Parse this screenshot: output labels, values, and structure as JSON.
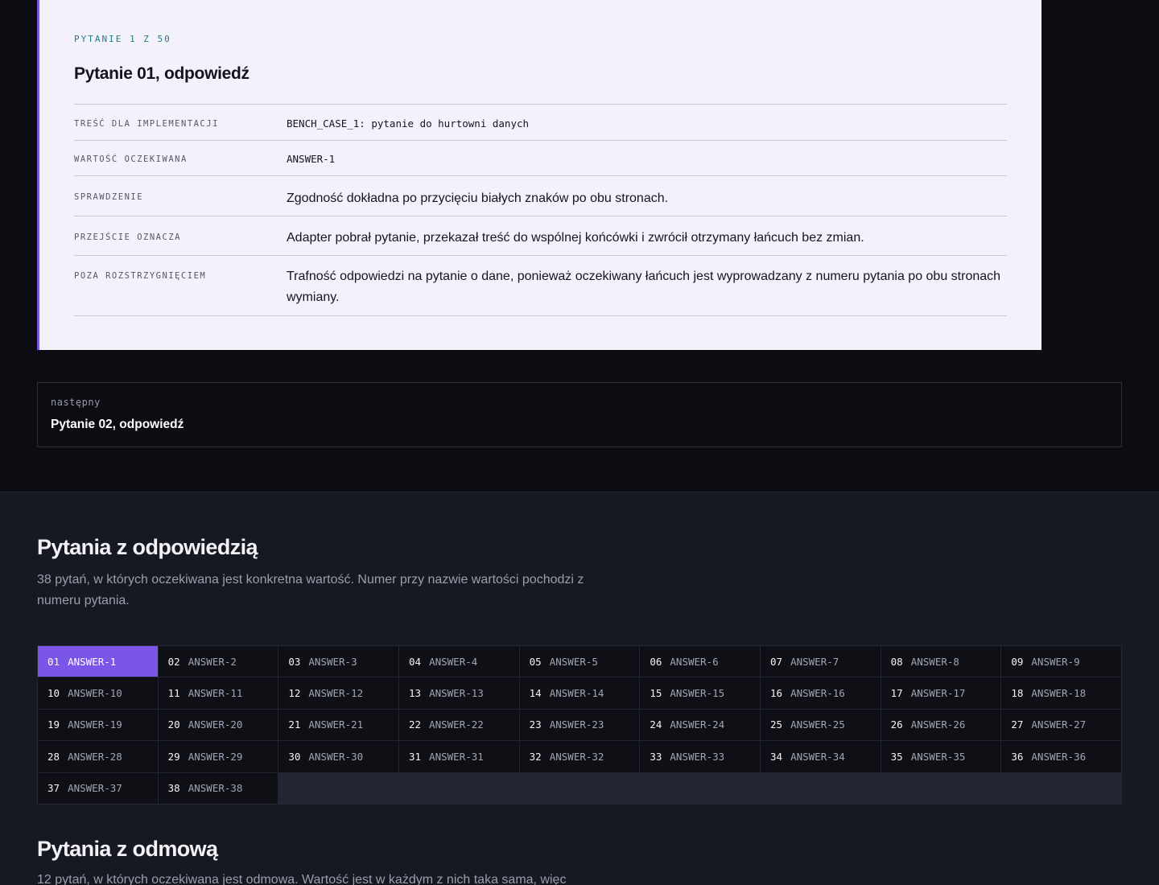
{
  "question_card": {
    "counter": "PYTANIE 1 Z 50",
    "title": "Pytanie 01, odpowiedź",
    "rows": [
      {
        "key": "TREŚĆ DLA IMPLEMENTACJI",
        "value": "BENCH_CASE_1: pytanie do hurtowni danych"
      },
      {
        "key": "WARTOŚĆ OCZEKIWANA",
        "value": "ANSWER-1"
      },
      {
        "key": "SPRAWDZENIE",
        "value": "Zgodność dokładna po przycięciu białych znaków po obu stronach."
      },
      {
        "key": "PRZEJŚCIE OZNACZA",
        "value": "Adapter pobrał pytanie, przekazał treść do wspólnej końcówki i zwrócił otrzymany łańcuch bez zmian."
      },
      {
        "key": "POZA ROZSTRZYGNIĘCIEM",
        "value": "Trafność odpowiedzi na pytanie o dane, ponieważ oczekiwany łańcuch jest wyprowadzany z numeru pytania po obu stronach wymiany."
      }
    ]
  },
  "next": {
    "label": "następny",
    "title": "Pytanie 02, odpowiedź"
  },
  "answer_section": {
    "title": "Pytania z odpowiedzią",
    "description": "38 pytań, w których oczekiwana jest konkretna wartość. Numer przy nazwie wartości pochodzi z numeru pytania.",
    "active_index": 0,
    "items": [
      {
        "num": "01",
        "label": "ANSWER-1"
      },
      {
        "num": "02",
        "label": "ANSWER-2"
      },
      {
        "num": "03",
        "label": "ANSWER-3"
      },
      {
        "num": "04",
        "label": "ANSWER-4"
      },
      {
        "num": "05",
        "label": "ANSWER-5"
      },
      {
        "num": "06",
        "label": "ANSWER-6"
      },
      {
        "num": "07",
        "label": "ANSWER-7"
      },
      {
        "num": "08",
        "label": "ANSWER-8"
      },
      {
        "num": "09",
        "label": "ANSWER-9"
      },
      {
        "num": "10",
        "label": "ANSWER-10"
      },
      {
        "num": "11",
        "label": "ANSWER-11"
      },
      {
        "num": "12",
        "label": "ANSWER-12"
      },
      {
        "num": "13",
        "label": "ANSWER-13"
      },
      {
        "num": "14",
        "label": "ANSWER-14"
      },
      {
        "num": "15",
        "label": "ANSWER-15"
      },
      {
        "num": "16",
        "label": "ANSWER-16"
      },
      {
        "num": "17",
        "label": "ANSWER-17"
      },
      {
        "num": "18",
        "label": "ANSWER-18"
      },
      {
        "num": "19",
        "label": "ANSWER-19"
      },
      {
        "num": "20",
        "label": "ANSWER-20"
      },
      {
        "num": "21",
        "label": "ANSWER-21"
      },
      {
        "num": "22",
        "label": "ANSWER-22"
      },
      {
        "num": "23",
        "label": "ANSWER-23"
      },
      {
        "num": "24",
        "label": "ANSWER-24"
      },
      {
        "num": "25",
        "label": "ANSWER-25"
      },
      {
        "num": "26",
        "label": "ANSWER-26"
      },
      {
        "num": "27",
        "label": "ANSWER-27"
      },
      {
        "num": "28",
        "label": "ANSWER-28"
      },
      {
        "num": "29",
        "label": "ANSWER-29"
      },
      {
        "num": "30",
        "label": "ANSWER-30"
      },
      {
        "num": "31",
        "label": "ANSWER-31"
      },
      {
        "num": "32",
        "label": "ANSWER-32"
      },
      {
        "num": "33",
        "label": "ANSWER-33"
      },
      {
        "num": "34",
        "label": "ANSWER-34"
      },
      {
        "num": "35",
        "label": "ANSWER-35"
      },
      {
        "num": "36",
        "label": "ANSWER-36"
      },
      {
        "num": "37",
        "label": "ANSWER-37"
      },
      {
        "num": "38",
        "label": "ANSWER-38"
      }
    ]
  },
  "refusal_section": {
    "title": "Pytania z odmową",
    "description": "12 pytań, w których oczekiwana jest odmowa. Wartość jest w każdym z nich taka sama, więc"
  },
  "colors": {
    "accent": "#7b55e8",
    "counter": "#1f7a86",
    "background": "#0c0d12"
  }
}
